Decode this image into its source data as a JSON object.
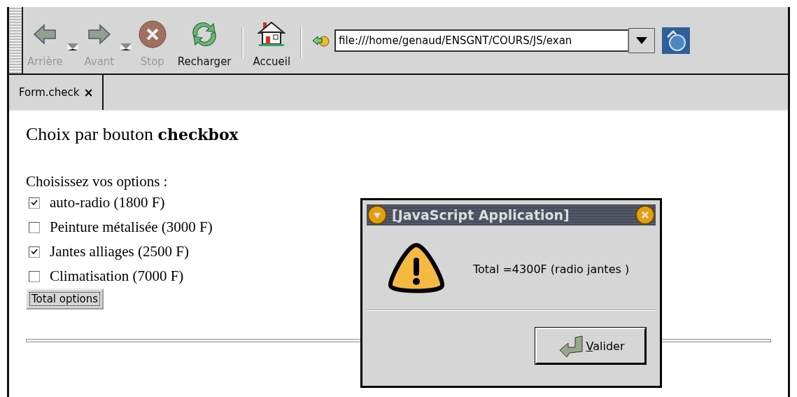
{
  "toolbar": {
    "buttons": [
      {
        "kind": "back",
        "label": "Arrière",
        "disabled": true,
        "has_menu": true
      },
      {
        "kind": "forward",
        "label": "Avant",
        "disabled": true,
        "has_menu": true
      },
      {
        "kind": "stop",
        "label": "Stop",
        "disabled": true,
        "has_menu": false
      },
      {
        "kind": "reload",
        "label": "Recharger",
        "disabled": false,
        "has_menu": false
      },
      {
        "kind": "home",
        "label": "Accueil",
        "disabled": false,
        "has_menu": false
      }
    ],
    "location": {
      "value": "file:///home/genaud/ENSGNT/COURS/JS/exan"
    }
  },
  "tabs": [
    {
      "label": "Form.check",
      "close": "×",
      "selected": true
    }
  ],
  "page": {
    "heading": "Choix par bouton **checkbox**",
    "prompt": "Choisissez vos options :",
    "options": [
      {
        "label": "auto-radio (1800 F)",
        "checked": true
      },
      {
        "label": "Peinture métalisée (3000 F)",
        "checked": false
      },
      {
        "label": "Jantes alliages (2500 F)",
        "checked": true
      },
      {
        "label": "Climatisation (7000 F)",
        "checked": false
      }
    ],
    "button": "Total options"
  },
  "dialog": {
    "title": "[JavaScript Application]",
    "message": "Total =4300F (radio jantes )",
    "button": "Valider"
  }
}
